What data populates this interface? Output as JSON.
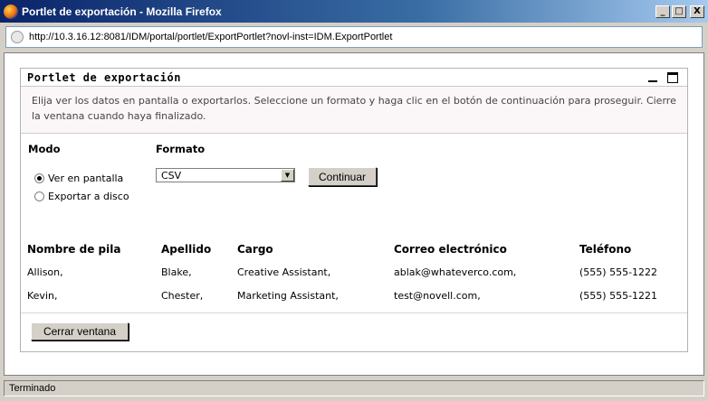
{
  "window": {
    "title": "Portlet de exportación - Mozilla Firefox",
    "minimize": "_",
    "maximize": "□",
    "close": "X"
  },
  "address": {
    "url": "http://10.3.16.12:8081/IDM/portal/portlet/ExportPortlet?novl-inst=IDM.ExportPortlet"
  },
  "portlet": {
    "title": "Portlet de exportación",
    "instructions": "Elija ver los datos en pantalla o exportarlos. Seleccione un formato y haga clic en el botón de continuación para proseguir. Cierre la ventana cuando haya finalizado.",
    "mode_label": "Modo",
    "format_label": "Formato",
    "mode_options": [
      {
        "label": "Ver en pantalla",
        "checked": true
      },
      {
        "label": "Exportar a disco",
        "checked": false
      }
    ],
    "format_value": "CSV",
    "continue_label": "Continuar",
    "close_label": "Cerrar ventana"
  },
  "table": {
    "headers": [
      "Nombre de pila",
      "Apellido",
      "Cargo",
      "Correo electrónico",
      "Teléfono"
    ],
    "rows": [
      [
        "Allison,",
        "Blake,",
        "Creative Assistant,",
        "ablak@whateverco.com,",
        "(555) 555-1222"
      ],
      [
        "Kevin,",
        "Chester,",
        "Marketing Assistant,",
        "test@novell.com,",
        "(555) 555-1221"
      ]
    ]
  },
  "status": {
    "text": "Terminado"
  }
}
